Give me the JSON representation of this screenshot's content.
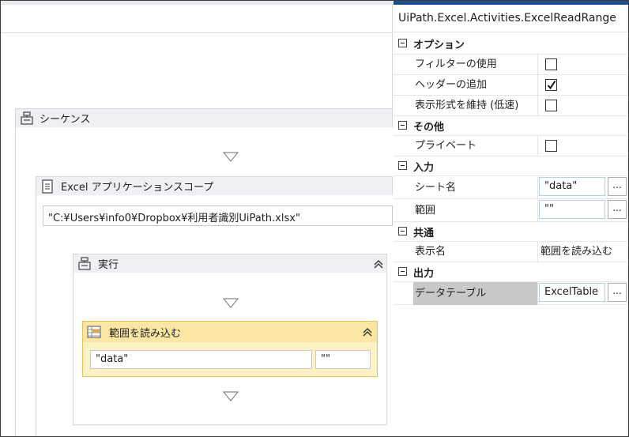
{
  "designer": {
    "sequence": {
      "title": "シーケンス"
    },
    "excel_scope": {
      "title": "Excel アプリケーションスコープ",
      "path": "\"C:¥Users¥info0¥Dropbox¥利用者識別UiPath.xlsx\""
    },
    "do_block": {
      "title": "実行"
    },
    "read_range": {
      "title": "範囲を読み込む",
      "sheet": "\"data\"",
      "range": "\"\""
    }
  },
  "properties": {
    "title": "UiPath.Excel.Activities.ExcelReadRange",
    "categories": [
      {
        "label": "オプション",
        "props": [
          {
            "name": "フィルターの使用",
            "checked": false
          },
          {
            "name": "ヘッダーの追加",
            "checked": true
          },
          {
            "name": "表示形式を維持 (低速)",
            "checked": false
          }
        ]
      },
      {
        "label": "その他",
        "props": [
          {
            "name": "プライベート",
            "checked": false
          }
        ]
      },
      {
        "label": "入力",
        "props": [
          {
            "name": "シート名",
            "value": "\"data\"",
            "button": "..."
          },
          {
            "name": "範囲",
            "value": "\"\"",
            "button": "..."
          }
        ]
      },
      {
        "label": "共通",
        "props": [
          {
            "name": "表示名",
            "value": "範囲を読み込む"
          }
        ]
      },
      {
        "label": "出力",
        "props": [
          {
            "name": "データテーブル",
            "value": "ExcelTable",
            "button": "..."
          }
        ]
      }
    ]
  }
}
